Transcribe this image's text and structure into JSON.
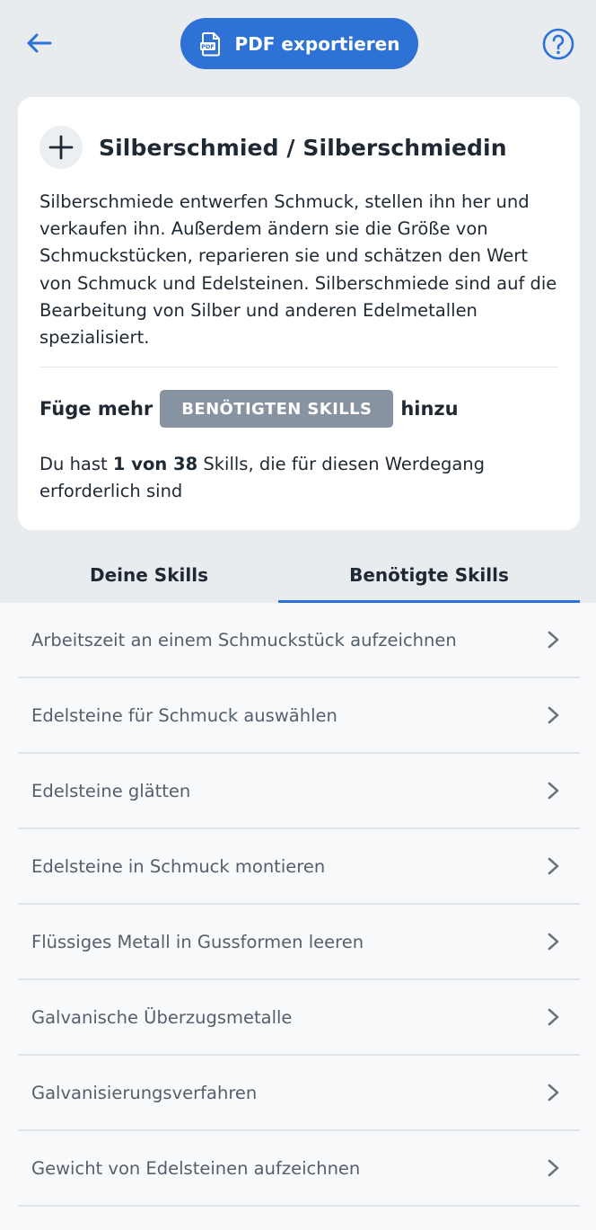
{
  "header": {
    "pdf_label": "PDF exportieren",
    "back_icon": "arrow-left-icon",
    "help_icon": "question-circle-icon",
    "accent": "#2f72d6"
  },
  "card": {
    "title": "Silberschmied / Silberschmiedin",
    "description": "Silberschmiede entwerfen Schmuck, stellen ihn her und verkaufen ihn. Außerdem ändern sie die Größe von Schmuckstücken, reparieren sie und schätzen den Wert von Schmuck und Edelsteinen. Silberschmiede sind auf die Bearbeitung von Silber und anderen Edelmetallen spezialisiert.",
    "add_prefix": "Füge mehr",
    "add_pill": "BENÖTIGTEN SKILLS",
    "add_suffix": "hinzu",
    "count_prefix": "Du hast ",
    "count_value": "1 von 38",
    "count_suffix": " Skills, die für diesen Werdegang erforderlich sind"
  },
  "tabs": [
    {
      "label": "Deine Skills",
      "active": false
    },
    {
      "label": "Benötigte Skills",
      "active": true
    }
  ],
  "skills": [
    {
      "label": "Arbeitszeit an einem Schmuckstück aufzeichnen"
    },
    {
      "label": "Edelsteine für Schmuck auswählen"
    },
    {
      "label": "Edelsteine glätten"
    },
    {
      "label": "Edelsteine in Schmuck montieren"
    },
    {
      "label": "Flüssiges Metall in Gussformen leeren"
    },
    {
      "label": "Galvanische Überzugsmetalle"
    },
    {
      "label": "Galvanisierungsverfahren"
    },
    {
      "label": "Gewicht von Edelsteinen aufzeichnen"
    }
  ]
}
